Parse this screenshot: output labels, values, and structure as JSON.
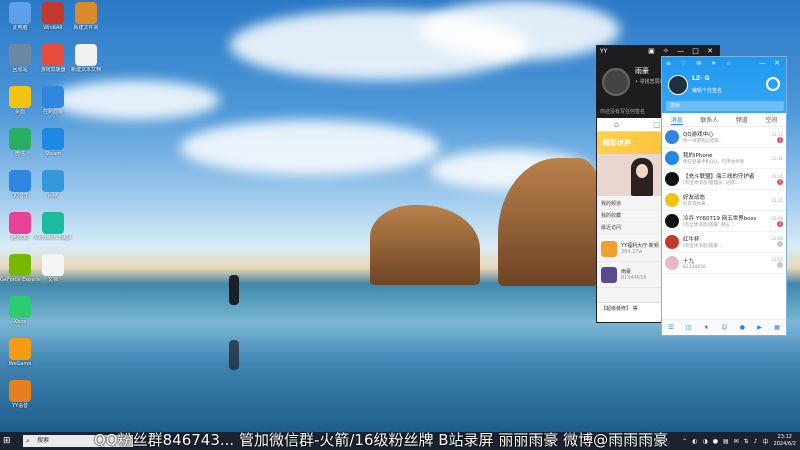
{
  "desktop": {
    "icons": [
      {
        "label": "此电脑",
        "color": "#5ea1e8"
      },
      {
        "label": "WinRAR",
        "color": "#c0392b"
      },
      {
        "label": "新建文件夹",
        "color": "#d88a2c"
      },
      {
        "label": "回收站",
        "color": "#6f87a3"
      },
      {
        "label": "游戏加速器",
        "color": "#e74c3c"
      },
      {
        "label": "新建文本文档",
        "color": "#f0f0f0"
      },
      {
        "label": "桌面",
        "color": "#f1c40f"
      },
      {
        "label": "控制面板",
        "color": "#2e86de"
      },
      {
        "label": "微信",
        "color": "#27ae60"
      },
      {
        "label": "Steam",
        "color": "#1e88e5"
      },
      {
        "label": "QQ音乐",
        "color": "#2e86de"
      },
      {
        "label": "网络",
        "color": "#3498db"
      },
      {
        "label": "腾讯QQ",
        "color": "#e84393"
      },
      {
        "label": "Microsoft Edge",
        "color": "#1abc9c"
      },
      {
        "label": "GeForce Experience",
        "color": "#76b900"
      },
      {
        "label": "文档",
        "color": "#f5f5f5"
      },
      {
        "label": "Xbox",
        "color": "#2ecc71"
      },
      {
        "label": "WeGame",
        "color": "#f39c12"
      },
      {
        "label": "YY语音",
        "color": "#e67e22"
      }
    ]
  },
  "yy": {
    "title": "YY",
    "controls": "▣ ✧ — □ ✕",
    "username": "雨豪",
    "subtitle": "• 寻找志同道合",
    "signature": "你还没有写任何签名",
    "nav": [
      "⌂",
      "▢",
      "☰"
    ],
    "banner": "精彩世界",
    "list": [
      "我的频道",
      "我的收藏",
      "最近访问"
    ],
    "rooms": [
      {
        "name": "YY福利大厅·新频",
        "id": "384.27w",
        "color": "#f0a030"
      },
      {
        "name": "雨豪",
        "id": "81344658",
        "color": "#5b4a8c"
      }
    ],
    "footer": "【超级装修】 等"
  },
  "qq": {
    "icons": "≡ ♡ ✉ ✦ ☆",
    "controls": "— ✕",
    "name": "LZ· G",
    "status": "编辑个性签名",
    "search_placeholder": "搜索",
    "tabs": [
      "消息",
      "联系人",
      "频道",
      "空间"
    ],
    "chats": [
      {
        "name": "QQ游戏中心",
        "msg": "你一场游戏已结束...",
        "time": "23:11",
        "badge": "1",
        "badge_type": "red",
        "color": "#2e86de"
      },
      {
        "name": "我的iPhone",
        "msg": "你已登录手机QQ，可传文件到",
        "time": "23:11",
        "badge": "",
        "badge_type": "",
        "color": "#1e88e5"
      },
      {
        "name": "【充斗联盟】海三线的守护者",
        "msg": "[有全体消息]管理员: 记得...",
        "time": "23:11",
        "badge": "1",
        "badge_type": "red",
        "color": "#111"
      },
      {
        "name": "好友动态",
        "msg": "好友等你来...",
        "time": "23:11",
        "badge": "",
        "badge_type": "",
        "color": "#f1c40f"
      },
      {
        "name": "冷兵 YY60719 网五世界boss",
        "msg": "[有全体消息]雨豪: 网五...",
        "time": "23:08",
        "badge": "1",
        "badge_type": "red",
        "color": "#111"
      },
      {
        "name": "红牛杯",
        "msg": "[有全体消息]雨豪...",
        "time": "23:08",
        "badge": "",
        "badge_type": "gray",
        "color": "#c0392b"
      },
      {
        "name": "十九",
        "msg": "81344658",
        "time": "23:05",
        "badge": "",
        "badge_type": "gray",
        "color": "#e6b8c8"
      }
    ],
    "bottom": [
      "☰",
      "◫",
      "★",
      "☺",
      "●",
      "▶",
      "▦"
    ]
  },
  "taskbar": {
    "start": "⊞",
    "search_text": "搜索",
    "marquee": "QQ粉丝群846743... 管加微信群-火箭/16级粉丝牌 B站录屏 丽丽雨豪 微博@雨雨雨豪",
    "tray": [
      "⌃",
      "◐",
      "◑",
      "●",
      "▤",
      "✉",
      "⇅",
      "♪",
      "中"
    ],
    "time": "23:12",
    "date": "2024/6/2"
  }
}
